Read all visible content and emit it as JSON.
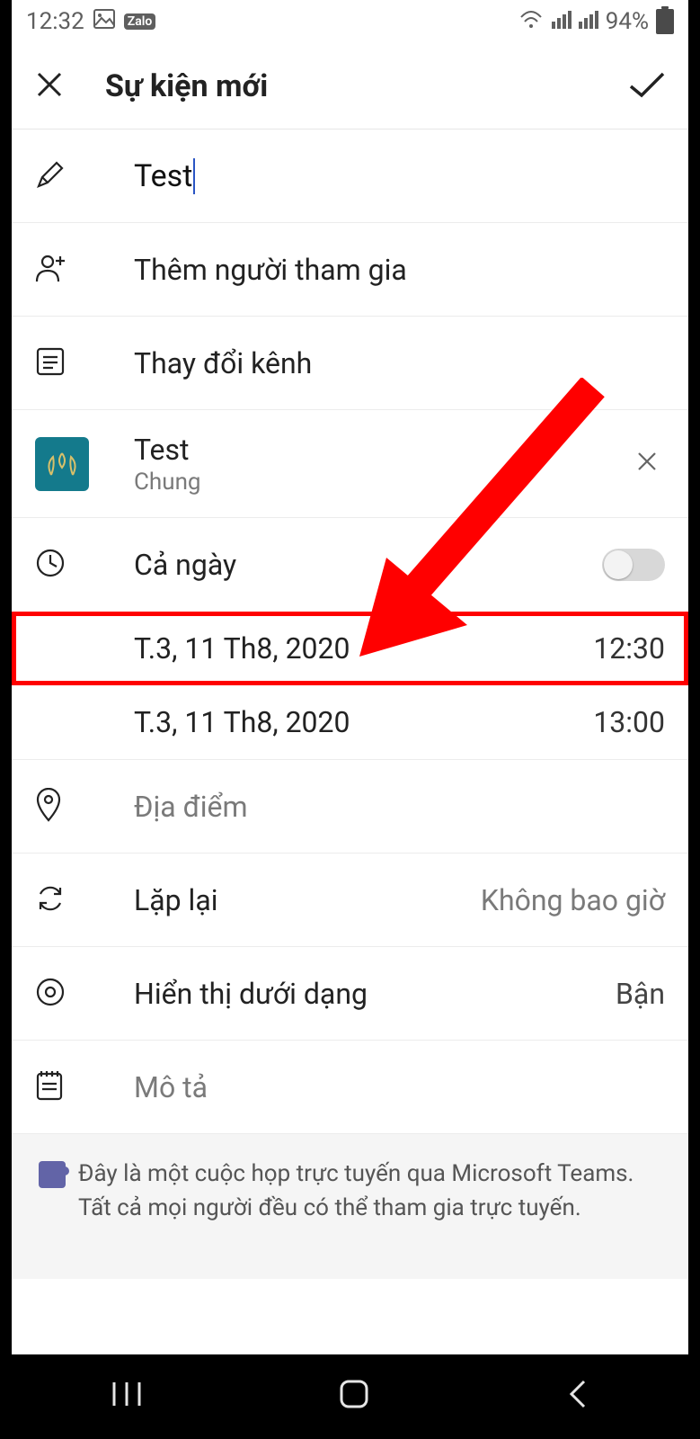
{
  "statusbar": {
    "time": "12:32",
    "battery": "94%"
  },
  "header": {
    "title": "Sự kiện mới"
  },
  "titleField": {
    "value": "Test"
  },
  "participants": {
    "placeholder": "Thêm người tham gia"
  },
  "channel": {
    "placeholder": "Thay đổi kênh"
  },
  "team": {
    "name": "Test",
    "sub": "Chung"
  },
  "allday": {
    "label": "Cả ngày",
    "on": false
  },
  "start": {
    "date": "T.3, 11 Th8, 2020",
    "time": "12:30"
  },
  "end": {
    "date": "T.3, 11 Th8, 2020",
    "time": "13:00"
  },
  "location": {
    "placeholder": "Địa điểm"
  },
  "repeat": {
    "label": "Lặp lại",
    "value": "Không bao giờ"
  },
  "showas": {
    "label": "Hiển thị dưới dạng",
    "value": "Bận"
  },
  "description": {
    "placeholder": "Mô tả"
  },
  "footnote": {
    "line1": "Đây là một cuộc họp trực tuyến qua Microsoft Teams.",
    "line2": "Tất cả mọi người đều có thể tham gia trực tuyến."
  }
}
